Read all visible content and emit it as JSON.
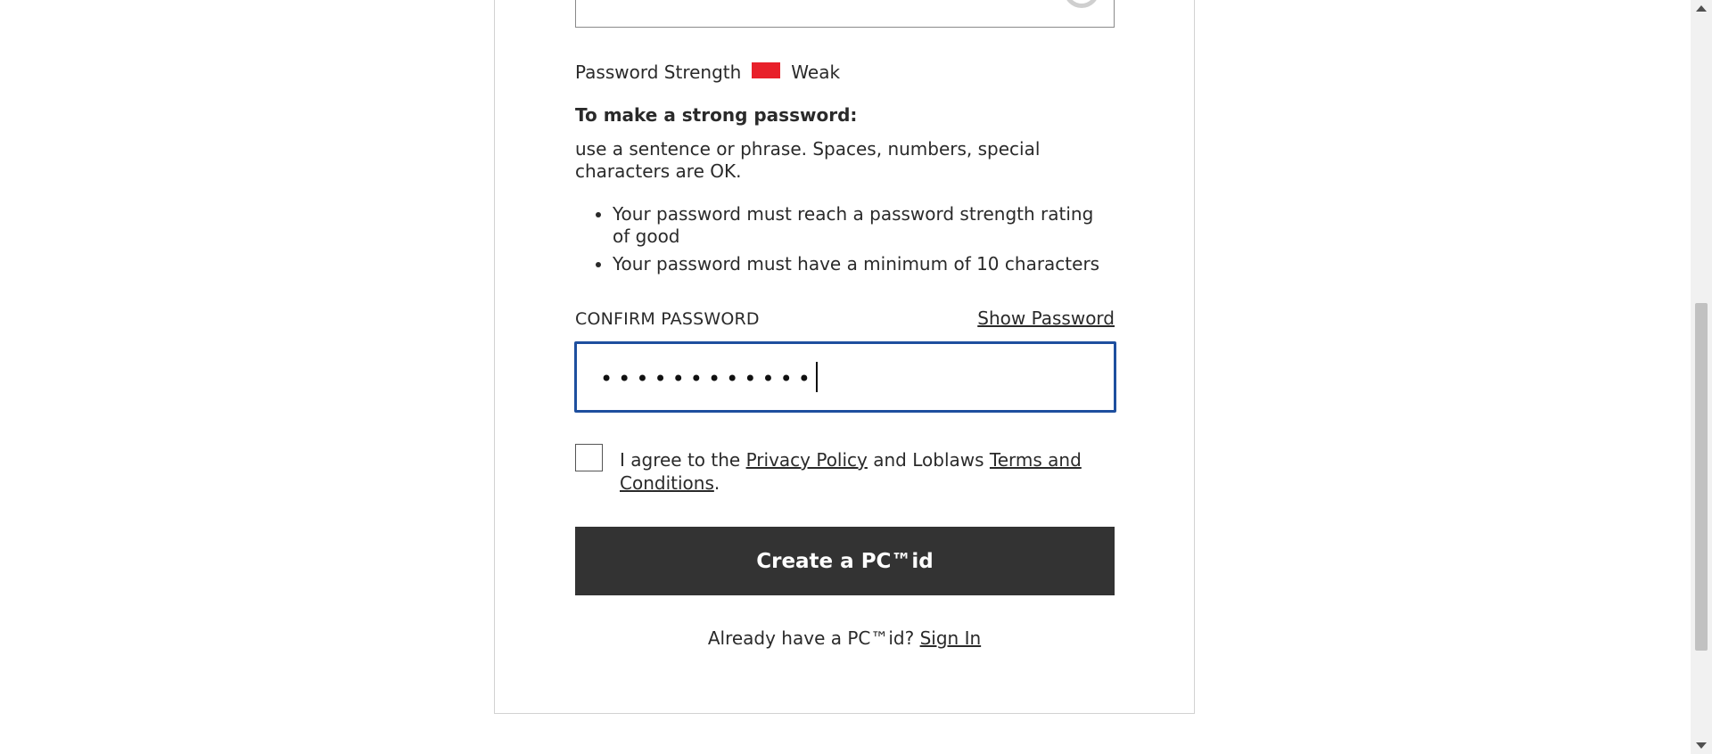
{
  "strength": {
    "label": "Password Strength",
    "value": "Weak",
    "bar_color": "#e8202a"
  },
  "guidance": {
    "heading": "To make a strong password:",
    "tip": "use a sentence or phrase. Spaces, numbers, special characters are OK.",
    "rules": [
      "Your password must reach a password strength rating of good",
      "Your password must have a minimum of 10 characters"
    ]
  },
  "confirm_password": {
    "label": "CONFIRM PASSWORD",
    "show_label": "Show Password",
    "masked_value": "••••••••••••"
  },
  "agreement": {
    "prefix": "I agree to the ",
    "privacy_link": "Privacy Policy",
    "middle": " and Loblaws ",
    "terms_link": "Terms and Conditions",
    "suffix": ".",
    "checked": false
  },
  "create_button": {
    "label": "Create a PC™id"
  },
  "signin": {
    "prompt": "Already have a PC™id? ",
    "link": "Sign In"
  },
  "colors": {
    "button_bg": "#333333",
    "focus_border": "#1e4f9e",
    "weak": "#e8202a"
  }
}
